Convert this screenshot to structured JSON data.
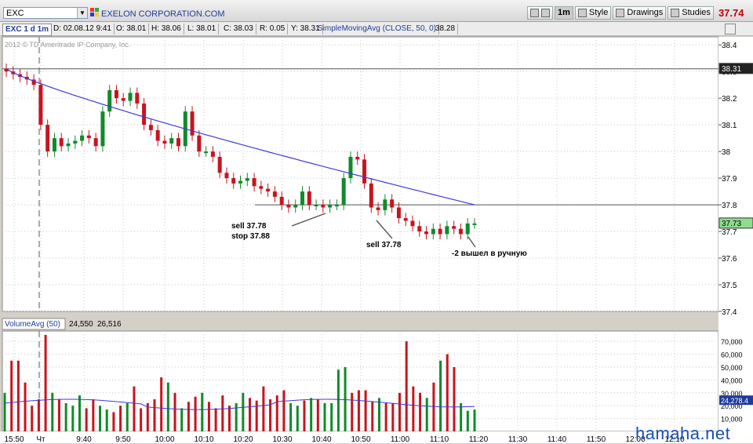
{
  "toolbar": {
    "symbol": "EXC",
    "company": "EXELON CORPORATION.COM",
    "interval_label": "1m",
    "style_label": "Style",
    "drawings_label": "Drawings",
    "studies_label": "Studies",
    "last_price": "37.74"
  },
  "header": {
    "title": "EXC 1 d 1m",
    "date": "D: 02.08.12 9:41",
    "open": "O: 38.01",
    "high": "H: 38.06",
    "low": "L: 38.01",
    "close": "C: 38.03",
    "range": "R: 0.05",
    "y": "Y: 38.31",
    "study": "SimpleMovingAvg (CLOSE, 50, 0)",
    "study_value": "38.28"
  },
  "copyright": "2012 © TD Ameritrade IP Company, Inc.",
  "price_axis": {
    "ticks": [
      "38.4",
      "38.3",
      "38.2",
      "38.1",
      "38",
      "37.9",
      "37.8",
      "37.7",
      "37.6",
      "37.5",
      "37.4"
    ],
    "marker_high": "38.31",
    "marker_last": "37.73"
  },
  "volume_header": {
    "title": "VolumeAvg (50)",
    "value1": "24,550",
    "value2": "26,516"
  },
  "volume_axis": {
    "ticks": [
      "70,000",
      "60,000",
      "50,000",
      "40,000",
      "30,000",
      "20,000",
      "10,000"
    ],
    "marker": "24,278.4"
  },
  "time_axis": [
    "15:50",
    "Чт",
    "9:40",
    "9:50",
    "10:00",
    "10:10",
    "10:20",
    "10:30",
    "10:40",
    "10:50",
    "11:00",
    "11:10",
    "11:20",
    "11:30",
    "11:40",
    "11:50",
    "12:00",
    "12:10"
  ],
  "annotations": {
    "a1_line1": "sell 37.78",
    "a1_line2": "stop 37.88",
    "a2": "sell 37.78",
    "a3": "-2 вышел в ручную"
  },
  "watermark": "hamaha.net",
  "colors": {
    "up": "#118a2a",
    "down": "#c8141e",
    "sma": "#3b3bd6",
    "watermark": "#1a4fb0"
  },
  "chart_data": {
    "type": "candlestick",
    "closes": [
      38.3,
      38.29,
      38.28,
      38.27,
      38.25,
      38.1,
      38.0,
      38.05,
      38.02,
      38.03,
      38.04,
      38.06,
      38.05,
      38.02,
      38.15,
      38.23,
      38.2,
      38.19,
      38.22,
      38.18,
      38.1,
      38.08,
      38.04,
      38.03,
      38.05,
      38.02,
      38.15,
      38.06,
      38.0,
      38.0,
      37.98,
      37.92,
      37.9,
      37.88,
      37.89,
      37.9,
      37.87,
      37.86,
      37.85,
      37.83,
      37.8,
      37.79,
      37.8,
      37.85,
      37.8,
      37.8,
      37.79,
      37.8,
      37.8,
      37.9,
      37.98,
      37.97,
      37.88,
      37.79,
      37.78,
      37.82,
      37.79,
      37.75,
      37.74,
      37.72,
      37.7,
      37.69,
      37.71,
      37.69,
      37.72,
      37.71,
      37.69,
      37.73,
      37.73
    ],
    "price_range": [
      37.4,
      38.43
    ],
    "sma_end": 37.8,
    "volumes": [
      30,
      55,
      55,
      38,
      20,
      25,
      75,
      30,
      25,
      22,
      20,
      28,
      18,
      25,
      20,
      17,
      15,
      20,
      22,
      35,
      18,
      22,
      25,
      42,
      38,
      30,
      18,
      23,
      27,
      30,
      23,
      18,
      28,
      20,
      22,
      30,
      26,
      24,
      35,
      25,
      28,
      32,
      22,
      20,
      24,
      26,
      25,
      22,
      22,
      48,
      50,
      30,
      32,
      32,
      23,
      26,
      22,
      22,
      30,
      70,
      35,
      30,
      26,
      38,
      55,
      60,
      50,
      22,
      16,
      17
    ],
    "volume_range": [
      0,
      78000
    ],
    "volume_avg_last": 24278.4
  }
}
